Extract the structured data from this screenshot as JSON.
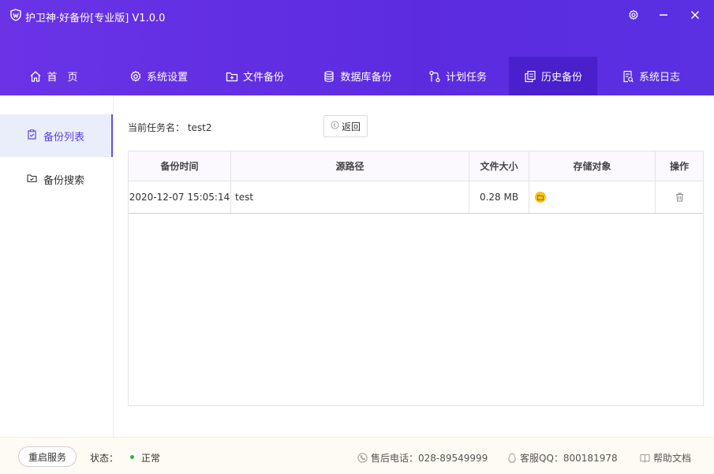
{
  "app": {
    "title": "护卫神·好备份[专业版]  V1.0.0"
  },
  "nav": {
    "items": [
      {
        "label": "首　页",
        "icon": "home-icon"
      },
      {
        "label": "系统设置",
        "icon": "gear-icon"
      },
      {
        "label": "文件备份",
        "icon": "folder-plus-icon"
      },
      {
        "label": "数据库备份",
        "icon": "database-icon"
      },
      {
        "label": "计划任务",
        "icon": "schedule-icon"
      },
      {
        "label": "历史备份",
        "icon": "copy-icon"
      },
      {
        "label": "系统日志",
        "icon": "log-icon"
      }
    ],
    "active": "历史备份"
  },
  "sidebar": {
    "items": [
      {
        "label": "备份列表",
        "icon": "clipboard-check-icon"
      },
      {
        "label": "备份搜索",
        "icon": "folder-search-icon"
      }
    ],
    "active": "备份列表"
  },
  "main": {
    "task_label": "当前任务名：  test2",
    "back_label": "返回"
  },
  "table": {
    "headers": [
      "备份时间",
      "源路径",
      "文件大小",
      "存储对象",
      "操作"
    ],
    "rows": [
      {
        "time": "2020-12-07 15:05:14",
        "path": "test",
        "size": "0.28 MB",
        "storage": "folder-icon",
        "action": "trash-icon"
      }
    ]
  },
  "footer": {
    "restart_label": "重启服务",
    "status_label": "状态：",
    "status_value": "正常",
    "phone": "售后电话：028-89549999",
    "qq": "客服QQ：800181978",
    "help": "帮助文档"
  },
  "colors": {
    "header_start": "#6a33e6",
    "header_end": "#5a30e2",
    "nav_active": "#4a1fcc",
    "accent": "#5a3ee0",
    "status_ok": "#2bb24c",
    "storage_icon": "#f6c21c"
  }
}
